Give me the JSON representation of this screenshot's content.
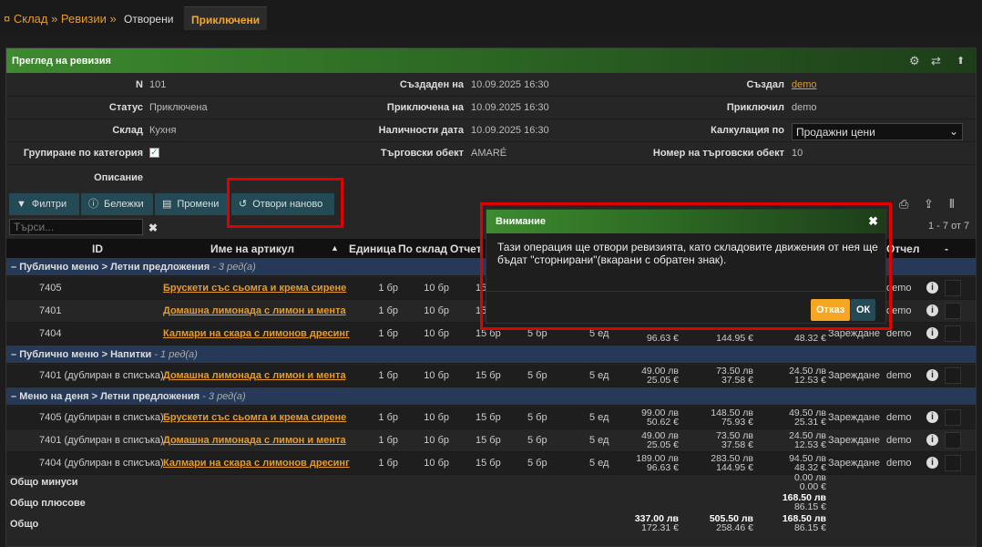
{
  "breadcrumb": {
    "text": "¤ Склад » Ревизии »"
  },
  "tabs": [
    {
      "label": "Отворени"
    },
    {
      "label": "Приключени"
    }
  ],
  "panel": {
    "title": "Преглед на ревизия"
  },
  "form": {
    "n_label": "N",
    "n_value": "101",
    "created_on_label": "Създаден на",
    "created_on_value": "10.09.2025 16:30",
    "created_by_label": "Създал",
    "created_by_value": "demo",
    "status_label": "Статус",
    "status_value": "Приключена",
    "closed_on_label": "Приключена на",
    "closed_on_value": "10.09.2025 16:30",
    "closed_by_label": "Приключил",
    "closed_by_value": "demo",
    "warehouse_label": "Склад",
    "warehouse_value": "Кухня",
    "stock_date_label": "Наличности дата",
    "stock_date_value": "10.09.2025 16:30",
    "calc_label": "Калкулация по",
    "calc_value": "Продажни цени",
    "group_label": "Групиране по категория",
    "group_checked": true,
    "outlet_label": "Търговски обект",
    "outlet_value": "AMARÉ",
    "outlet_no_label": "Номер на търговски обект",
    "outlet_no_value": "10",
    "description_label": "Описание",
    "description_value": ""
  },
  "toolbar": {
    "filters": "Филтри",
    "notes": "Бележки",
    "changes": "Промени",
    "reopen": "Отвори наново"
  },
  "search": {
    "placeholder": "Търси..."
  },
  "pagination": {
    "text": "1 - 7 от 7"
  },
  "table": {
    "headers": {
      "id": "ID",
      "name": "Име на артикул",
      "unit": "Единица",
      "by_warehouse": "По склад",
      "counted": "Отчет",
      "report": "Отчел",
      "last": "-"
    },
    "groups": [
      {
        "title": "Публично меню > Летни предложения",
        "count": "- 3 ред(а)",
        "rows": [
          {
            "id": "7405",
            "name": "Брускети със сьомга и крема сирене",
            "unit": "1 бр",
            "stock": "10 бр",
            "counted": "15",
            "c1": "",
            "c2": "",
            "c3": "",
            "m1a": "",
            "m1b": "",
            "m2a": "",
            "m2b": "",
            "m3a": "",
            "m3b": "",
            "type": "",
            "user": "demo"
          },
          {
            "id": "7401",
            "name": "Домашна лимонада с лимон и мента",
            "unit": "1 бр",
            "stock": "10 бр",
            "counted": "15",
            "c1": "",
            "c2": "",
            "c3": "",
            "m1a": "",
            "m1b": "",
            "m2a": "",
            "m2b": "",
            "m3a": "",
            "m3b": "",
            "type": "",
            "user": "demo"
          },
          {
            "id": "7404",
            "name": "Калмари на скара с лимонов дресинг",
            "unit": "1 бр",
            "stock": "10 бр",
            "counted": "15 бр",
            "c1": "5 бр",
            "c2": "5 ед",
            "c3": "",
            "m1a": "",
            "m1b": "96.63 €",
            "m2a": "",
            "m2b": "144.95 €",
            "m3a": "",
            "m3b": "48.32 €",
            "type": "Зареждане",
            "user": "demo"
          }
        ]
      },
      {
        "title": "Публично меню > Напитки",
        "count": "- 1 ред(а)",
        "rows": [
          {
            "id": "7401 (дублиран в списъка)",
            "name": "Домашна лимонада с лимон и мента",
            "unit": "1 бр",
            "stock": "10 бр",
            "counted": "15 бр",
            "c1": "5 бр",
            "c2": "5 ед",
            "c3": "",
            "m1a": "49.00 лв",
            "m1b": "25.05 €",
            "m2a": "73.50 лв",
            "m2b": "37.58 €",
            "m3a": "24.50 лв",
            "m3b": "12.53 €",
            "type": "Зареждане",
            "user": "demo"
          }
        ]
      },
      {
        "title": "Меню на деня > Летни предложения",
        "count": "- 3 ред(а)",
        "rows": [
          {
            "id": "7405 (дублиран в списъка)",
            "name": "Брускети със сьомга и крема сирене",
            "unit": "1 бр",
            "stock": "10 бр",
            "counted": "15 бр",
            "c1": "5 бр",
            "c2": "5 ед",
            "c3": "",
            "m1a": "99.00 лв",
            "m1b": "50.62 €",
            "m2a": "148.50 лв",
            "m2b": "75.93 €",
            "m3a": "49.50 лв",
            "m3b": "25.31 €",
            "type": "Зареждане",
            "user": "demo"
          },
          {
            "id": "7401 (дублиран в списъка)",
            "name": "Домашна лимонада с лимон и мента",
            "unit": "1 бр",
            "stock": "10 бр",
            "counted": "15 бр",
            "c1": "5 бр",
            "c2": "5 ед",
            "c3": "",
            "m1a": "49.00 лв",
            "m1b": "25.05 €",
            "m2a": "73.50 лв",
            "m2b": "37.58 €",
            "m3a": "24.50 лв",
            "m3b": "12.53 €",
            "type": "Зареждане",
            "user": "demo"
          },
          {
            "id": "7404 (дублиран в списъка)",
            "name": "Калмари на скара с лимонов дресинг",
            "unit": "1 бр",
            "stock": "10 бр",
            "counted": "15 бр",
            "c1": "5 бр",
            "c2": "5 ед",
            "c3": "",
            "m1a": "189.00 лв",
            "m1b": "96.63 €",
            "m2a": "283.50 лв",
            "m2b": "144.95 €",
            "m3a": "94.50 лв",
            "m3b": "48.32 €",
            "type": "Зареждане",
            "user": "demo"
          }
        ]
      }
    ]
  },
  "totals": {
    "minus_label": "Общо минуси",
    "minus_a": "0.00 лв",
    "minus_b": "0.00 €",
    "plus_label": "Общо плюсове",
    "plus_a": "168.50 лв",
    "plus_b": "86.15 €",
    "total_label": "Общо",
    "total_1a": "337.00 лв",
    "total_1b": "172.31 €",
    "total_2a": "505.50 лв",
    "total_2b": "258.46 €",
    "total_3a": "168.50 лв",
    "total_3b": "86.15 €"
  },
  "modal": {
    "title": "Внимание",
    "message": "Тази операция ще отвори ревизията, като складовите движения от нея ще бъдат \"сторнирани\"(вкарани с обратен знак).",
    "cancel": "Отказ",
    "ok": "ОК"
  },
  "colors": {
    "accent": "#e39b2f",
    "header_green": "#3d8a2f",
    "group_blue": "#263a58",
    "highlight": "#e00000"
  }
}
